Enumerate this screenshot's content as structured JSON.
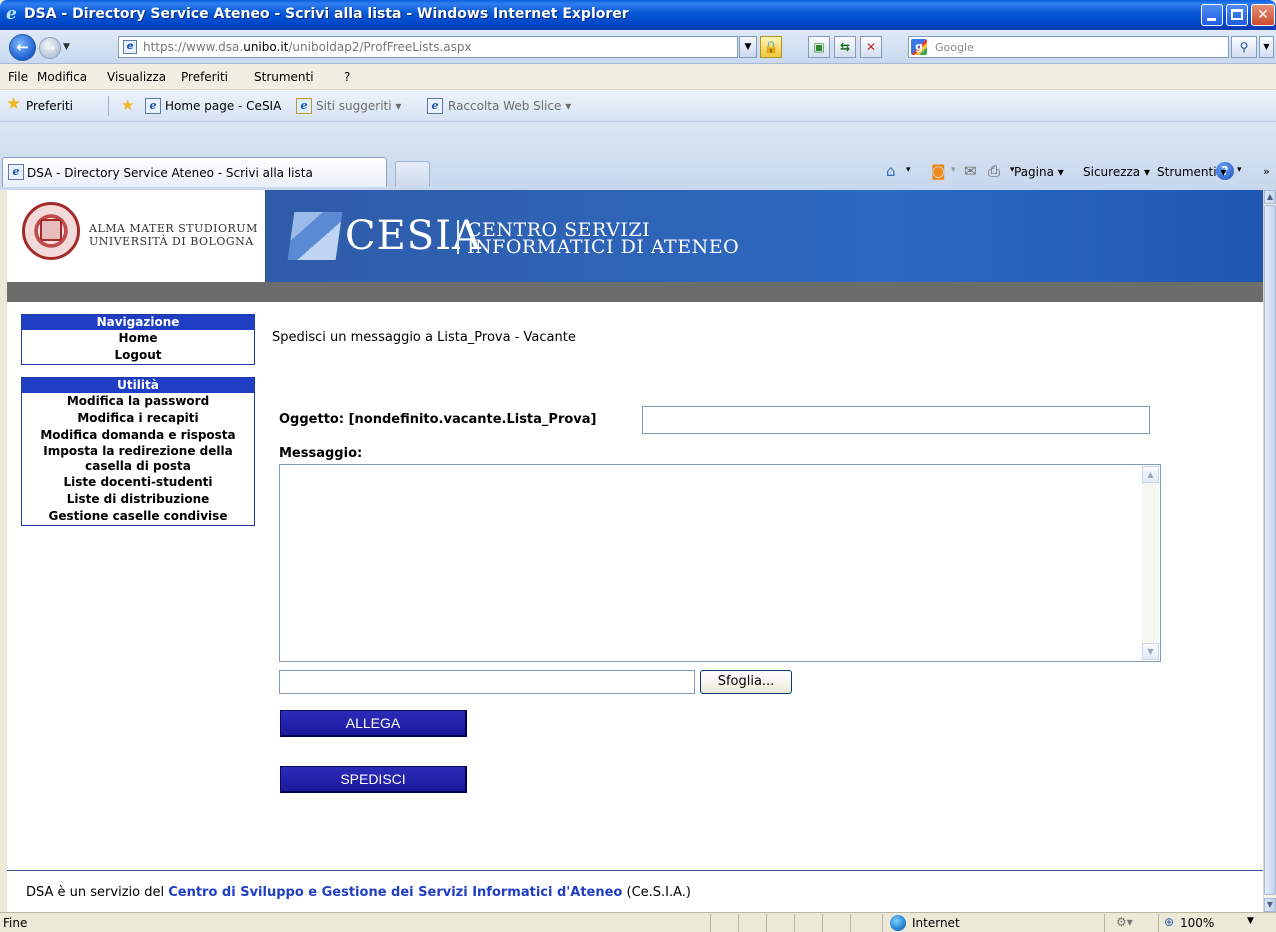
{
  "window": {
    "title": "DSA - Directory Service Ateneo - Scrivi alla lista - Windows Internet Explorer"
  },
  "address": {
    "url_prefix": "https://www.dsa.",
    "url_domain": "unibo.it",
    "url_path": "/uniboldap2/ProfFreeLists.aspx",
    "search_placeholder": "Google"
  },
  "menu": {
    "items": [
      "File",
      "Modifica",
      "Visualizza",
      "Preferiti",
      "Strumenti",
      "?"
    ]
  },
  "favorites": {
    "label": "Preferiti",
    "links": [
      "Home page - CeSIA",
      "Siti suggeriti ▾",
      "Raccolta Web Slice ▾"
    ]
  },
  "tabs": {
    "active_title": "DSA - Directory Service Ateneo - Scrivi alla lista"
  },
  "commandbar": {
    "pagina": "Pagina ▾",
    "sicurezza": "Sicurezza ▾",
    "strumenti": "Strumenti ▾"
  },
  "banner": {
    "uni_line1": "ALMA MATER STUDIORUM",
    "uni_line2": "UNIVERSITÀ DI BOLOGNA",
    "cesia": "CESIA",
    "sub_line1": "CENTRO SERVIZI",
    "sub_line2": "INFORMATICI DI ATENEO"
  },
  "nav": {
    "section1_title": "Navigazione",
    "section1_items": [
      "Home",
      "Logout"
    ],
    "section2_title": "Utilità",
    "section2_items": [
      "Modifica la password",
      "Modifica i recapiti",
      "Modifica domanda e risposta",
      "Imposta la redirezione della casella di posta",
      "Liste docenti-studenti",
      "Liste di distribuzione",
      "Gestione caselle condivise"
    ]
  },
  "form": {
    "heading": "Spedisci un messaggio a Lista_Prova - Vacante",
    "subject_label": "Oggetto: [nondefinito.vacante.Lista_Prova]",
    "subject_value": "",
    "message_label": "Messaggio:",
    "message_value": "",
    "file_value": "",
    "browse_label": "Sfoglia...",
    "attach_label": "ALLEGA",
    "send_label": "SPEDISCI"
  },
  "footer": {
    "prefix": "DSA è un servizio del ",
    "link": "Centro di Sviluppo e Gestione dei Servizi Informatici d'Ateneo",
    "suffix": " (Ce.S.I.A.)"
  },
  "status": {
    "text": "Fine",
    "zone": "Internet",
    "zoom": "100%"
  },
  "colors": {
    "titlebar": "#0758d6",
    "nav_header": "#1f3ec4",
    "action_button": "#1a1a9e",
    "banner_blue": "#2d6ac2",
    "footer_link": "#1f3ec4"
  }
}
